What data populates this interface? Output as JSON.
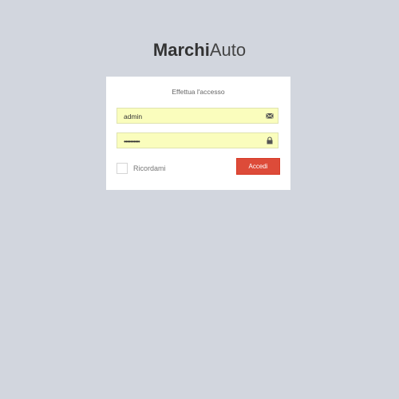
{
  "logo": {
    "bold": "Marchi",
    "light": "Auto"
  },
  "login": {
    "title": "Effettua l'accesso",
    "username": {
      "value": "admin",
      "icon": "envelope-icon"
    },
    "password": {
      "value": "••••••••••",
      "icon": "lock-icon"
    },
    "remember_label": "Ricordami",
    "remember_checked": false,
    "submit_label": "Accedi"
  },
  "colors": {
    "background": "#d2d6de",
    "button": "#dd4b39",
    "input_autofill": "#fafdbd"
  }
}
